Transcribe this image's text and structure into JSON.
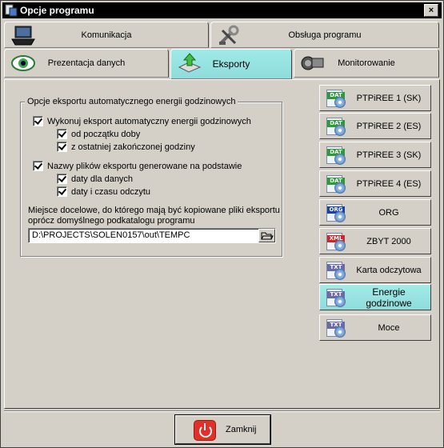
{
  "window": {
    "title": "Opcje programu",
    "close_label": "×"
  },
  "tabs_row1": [
    {
      "label": "Komunikacja",
      "icon": "laptop-icon"
    },
    {
      "label": "Obsługa programu",
      "icon": "tools-icon"
    }
  ],
  "tabs_row2": [
    {
      "label": "Prezentacja danych",
      "icon": "eye-icon"
    },
    {
      "label": "Eksporty",
      "icon": "export-arrow-icon",
      "active": true
    },
    {
      "label": "Monitorowanie",
      "icon": "camera-icon"
    }
  ],
  "group": {
    "title": "Opcje eksportu automatycznego energii godzinowych",
    "cb_auto": "Wykonuj eksport automatyczny energii godzinowych",
    "cb_from_start": "od początku doby",
    "cb_last_hour": "z ostatniej zakończonej godziny",
    "cb_names": "Nazwy plików eksportu generowane na podstawie",
    "cb_data_date": "daty dla danych",
    "cb_read_date": "daty i czasu odczytu",
    "dest_text_1": "Miejsce docelowe, do którego mają być kopiowane pliki eksportu",
    "dest_text_2": "oprócz domyślnego podkatalogu programu",
    "path_value": "D:\\PROJECTS\\SOLEN0157\\out\\TEMPC"
  },
  "side_buttons": [
    {
      "label": "PTPiREE 1 (SK)",
      "tag": "DAT",
      "color": "#2a9a3a"
    },
    {
      "label": "PTPiREE 2 (ES)",
      "tag": "DAT",
      "color": "#2a9a3a"
    },
    {
      "label": "PTPiREE 3 (SK)",
      "tag": "DAT",
      "color": "#2a9a3a"
    },
    {
      "label": "PTPiREE 4 (ES)",
      "tag": "DAT",
      "color": "#2a9a3a"
    },
    {
      "label": "ORG",
      "tag": "ORG",
      "color": "#1b3fa8"
    },
    {
      "label": "ZBYT 2000",
      "tag": "XML",
      "color": "#c82a2a"
    },
    {
      "label": "Karta odczytowa",
      "tag": "TXT",
      "color": "#6a6aa8"
    },
    {
      "label": "Energie godzinowe",
      "tag": "TXT",
      "color": "#6a6aa8",
      "active": true
    },
    {
      "label": "Moce",
      "tag": "TXT",
      "color": "#6a6aa8"
    }
  ],
  "close_button": {
    "label": "Zamknij"
  }
}
